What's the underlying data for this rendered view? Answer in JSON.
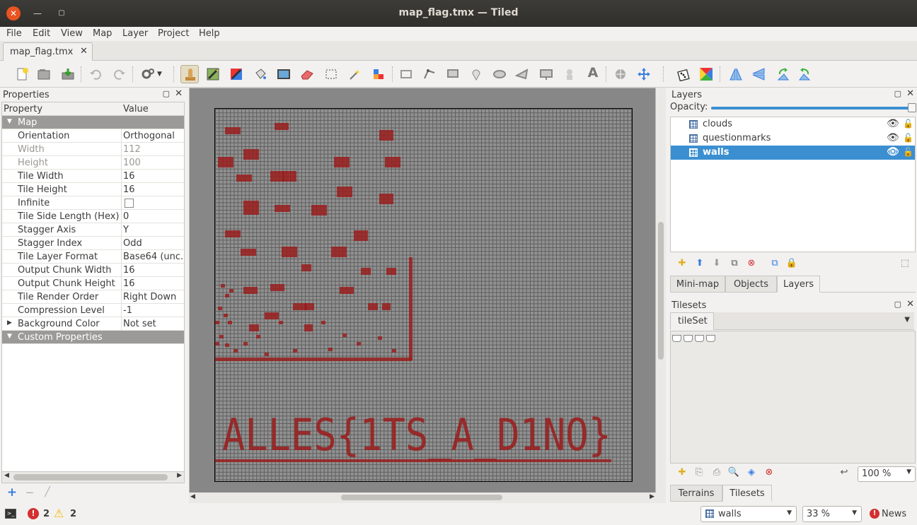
{
  "window": {
    "title": "map_flag.tmx — Tiled"
  },
  "menu": [
    "File",
    "Edit",
    "View",
    "Map",
    "Layer",
    "Project",
    "Help"
  ],
  "document_tab": {
    "label": "map_flag.tmx",
    "close": "✕"
  },
  "toolbar": {
    "icons": [
      "new-map-icon",
      "open-icon",
      "save-icon",
      "undo-icon",
      "redo-icon",
      "commands-icon",
      "stamp-brush-icon",
      "terrain-brush-icon",
      "wang-brush-icon",
      "bucket-fill-icon",
      "shape-fill-icon",
      "eraser-icon",
      "rect-select-icon",
      "magic-wand-icon",
      "select-same-tile-icon",
      "select-objects-icon",
      "edit-polygons-icon",
      "insert-rectangle-icon",
      "insert-point-icon",
      "insert-ellipse-icon",
      "insert-polygon-icon",
      "insert-tile-icon",
      "insert-template-icon",
      "insert-text-icon",
      "world-tool-icon",
      "move-icon",
      "random-mode-icon",
      "wang-fill-icon",
      "flip-horizontal-icon",
      "flip-vertical-icon",
      "rotate-left-icon",
      "rotate-right-icon"
    ]
  },
  "properties": {
    "title": "Properties",
    "col_property": "Property",
    "col_value": "Value",
    "group_map": "Map",
    "rows": [
      {
        "name": "Orientation",
        "value": "Orthogonal"
      },
      {
        "name": "Width",
        "value": "112"
      },
      {
        "name": "Height",
        "value": "100"
      },
      {
        "name": "Tile Width",
        "value": "16"
      },
      {
        "name": "Tile Height",
        "value": "16"
      },
      {
        "name": "Infinite",
        "value": ""
      },
      {
        "name": "Tile Side Length (Hex)",
        "value": "0"
      },
      {
        "name": "Stagger Axis",
        "value": "Y"
      },
      {
        "name": "Stagger Index",
        "value": "Odd"
      },
      {
        "name": "Tile Layer Format",
        "value": "Base64 (unc..."
      },
      {
        "name": "Output Chunk Width",
        "value": "16"
      },
      {
        "name": "Output Chunk Height",
        "value": "16"
      },
      {
        "name": "Tile Render Order",
        "value": "Right Down"
      },
      {
        "name": "Compression Level",
        "value": "-1"
      },
      {
        "name": "Background Color",
        "value": "Not set"
      }
    ],
    "group_custom": "Custom Properties"
  },
  "map": {
    "flag_text": "ALLES{1TS_A_D1NO}",
    "tile_color": "#9b1b1b"
  },
  "layers": {
    "title": "Layers",
    "opacity_label": "Opacity:",
    "opacity": 1.0,
    "items": [
      {
        "name": "clouds",
        "selected": false
      },
      {
        "name": "questionmarks",
        "selected": false
      },
      {
        "name": "walls",
        "selected": true
      }
    ],
    "tabs": [
      "Mini-map",
      "Objects",
      "Layers"
    ]
  },
  "tilesets": {
    "title": "Tilesets",
    "tab": "tileSet",
    "zoom": "100 %",
    "tabs": [
      "Terrains",
      "Tilesets"
    ]
  },
  "status": {
    "errors": "2",
    "warnings": "2",
    "layer_select": "walls",
    "zoom": "33 %",
    "news": "News"
  },
  "colors": {
    "accent": "#3b8fd1",
    "close_button": "#e95420",
    "error": "#d32f2f",
    "warning": "#f5b800"
  }
}
